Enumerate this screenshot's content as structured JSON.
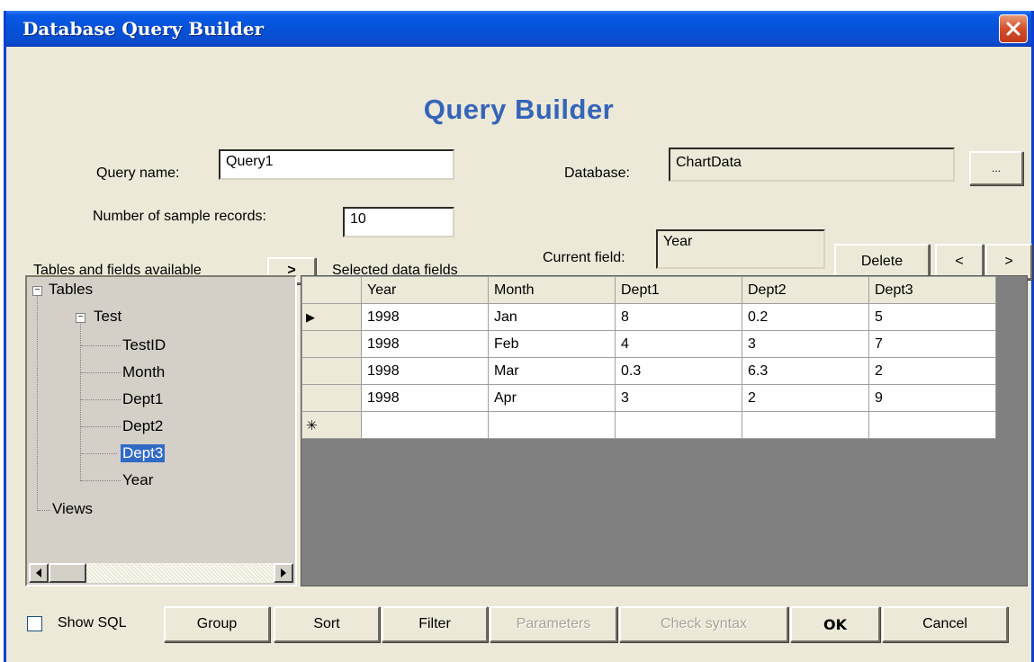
{
  "window": {
    "title": "Database Query Builder"
  },
  "heading": "Query Builder",
  "form": {
    "query_name_label": "Query name:",
    "query_name_value": "Query1",
    "database_label": "Database:",
    "database_value": "ChartData",
    "browse_label": "...",
    "sample_records_label": "Number of sample records:",
    "sample_records_value": "10",
    "current_field_label": "Current field:",
    "current_field_value": "Year"
  },
  "toolbar": {
    "tables_label": "Tables and fields available",
    "add_field_label": ">",
    "selected_label": "Selected data fields",
    "delete_label": "Delete",
    "move_left_label": "<",
    "move_right_label": ">"
  },
  "tree": {
    "root": "Tables",
    "table": "Test",
    "fields": [
      "TestID",
      "Month",
      "Dept1",
      "Dept2",
      "Dept3",
      "Year"
    ],
    "selected_field": "Dept3",
    "views": "Views"
  },
  "grid": {
    "columns": [
      "Year",
      "Month",
      "Dept1",
      "Dept2",
      "Dept3"
    ],
    "rows": [
      [
        "1998",
        "Jan",
        "8",
        "0.2",
        "5"
      ],
      [
        "1998",
        "Feb",
        "4",
        "3",
        "7"
      ],
      [
        "1998",
        "Mar",
        "0.3",
        "6.3",
        "2"
      ],
      [
        "1998",
        "Apr",
        "3",
        "2",
        "9"
      ]
    ],
    "current_row_marker": "▶",
    "new_row_marker": "✳"
  },
  "footer": {
    "show_sql_label": "Show SQL",
    "show_sql_checked": false,
    "group_label": "Group",
    "sort_label": "Sort",
    "filter_label": "Filter",
    "parameters_label": "Parameters",
    "check_syntax_label": "Check syntax",
    "ok_label": "OK",
    "cancel_label": "Cancel"
  }
}
